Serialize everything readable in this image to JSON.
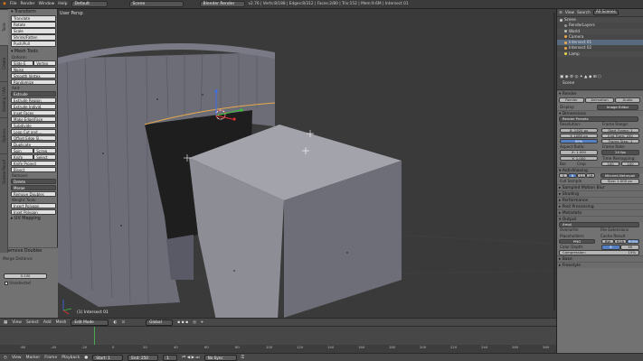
{
  "topbar": {
    "menus": [
      "File",
      "Render",
      "Window",
      "Help"
    ],
    "screen_layout": "Default",
    "scene": "Scene",
    "engine": "Blender Render",
    "stats": "v2.76 | Verts:8/188 | Edges:8/312 | Faces:2/80 | Tris:152 | Mem:9.6M | Intersect 01"
  },
  "toolshelf": {
    "tabs": [
      "Tools",
      "Create",
      "Shading / UVs",
      "Options",
      "Grease Pencil"
    ],
    "transform_header": "▾ Transform",
    "transform_buttons": [
      "Translate",
      "Rotate",
      "Scale",
      "Shrink/Fatten",
      "Push/Pull"
    ],
    "meshtools_header": "▾ Mesh Tools",
    "deform_label": "Deform:",
    "deform_row": [
      "Slide E",
      "Vertex"
    ],
    "deform_buttons": [
      "Noise",
      "Smooth Vertex",
      "Randomize"
    ],
    "add_label": "Add:",
    "add_dropdown": "Extrude",
    "add_buttons": [
      "Extrude Region",
      "Extrude Individ.",
      "Inset Faces",
      "Make Edge/Face",
      "Subdivide",
      "Loop Cut and ...",
      "Offset Edge Sl...",
      "Duplicate"
    ],
    "spin_row": [
      "Spin",
      "Screw"
    ],
    "knife_row": [
      "Knife",
      "Select"
    ],
    "knife_project": "Knife Project",
    "bisect": "Bisect",
    "remove_label": "Remove:",
    "remove_dropdowns": [
      "Delete",
      "Merge"
    ],
    "remove_doubles": "Remove Doubles",
    "weight_label": "Weight Tools:",
    "weight_buttons": [
      "Insert Polygon",
      "Inset Polygon"
    ],
    "uv_header": "▸ UV Mapping",
    "operator_header": "▾ Remove Doubles",
    "merge_distance_label": "Merge Distance",
    "merge_distance_value": "0.100",
    "unselected_label": "Unselected"
  },
  "viewport": {
    "title": "User Persp",
    "object_label": "(1) Intersect 01"
  },
  "viewport_header": {
    "menus": [
      "View",
      "Select",
      "Add",
      "Mesh"
    ],
    "mode": "Edit Mode",
    "pivot": "Global"
  },
  "timeline": {
    "ticks": [
      "-60",
      "-40",
      "-20",
      "0",
      "20",
      "40",
      "60",
      "80",
      "100",
      "120",
      "140",
      "160",
      "180",
      "200",
      "220",
      "240",
      "260",
      "280"
    ]
  },
  "timeline_header": {
    "menus": [
      "View",
      "Marker",
      "Frame",
      "Playback"
    ],
    "start": "Start: 1",
    "end": "End: 250",
    "current": "1",
    "sync": "No Sync"
  },
  "outliner": {
    "header": [
      "View",
      "Search",
      "All Scenes"
    ],
    "rows": [
      "Scene",
      "RenderLayers",
      "World",
      "Camera",
      "Intersect 01",
      "Intersect 02",
      "Lamp"
    ]
  },
  "properties": {
    "scene_label": "Scene",
    "render_header": "▾ Render",
    "render_buttons": [
      "Render",
      "Animation",
      "Audio"
    ],
    "display_label": "Display:",
    "display_value": "Image Editor",
    "dimensions_header": "▾ Dimensions",
    "render_presets": "Render Presets",
    "resolution_label": "Resolution:",
    "res_x": "X: 1920 px",
    "res_y": "Y: 1080 px",
    "res_pct": "50%",
    "frame_range_label": "Frame Range:",
    "start_frame": "Start Frame: 1",
    "end_frame": "End Fram: 250",
    "frame_step": "Frame Step: 1",
    "aspect_label": "Aspect Ratio:",
    "aspect_x": "X: 1.000",
    "aspect_y": "Y: 1.000",
    "frame_rate_label": "Frame Rate:",
    "frame_rate": "24 fps",
    "time_remap_label": "Time Remapping:",
    "remap_old": "100",
    "remap_new": "100",
    "border_label": "Bor",
    "crop_label": "Crop",
    "aa_header": "▾ Anti-Aliasing",
    "aa_samples": [
      "5",
      "8",
      "11",
      "16"
    ],
    "aa_filter": "Mitchell-Netravali",
    "full_sample": "Full Sample",
    "aa_size": "Size: 1.000 px",
    "collapsed_sections": [
      "▸ Sampled Motion Blur",
      "▸ Shading",
      "▸ Performance",
      "▸ Post Processing",
      "▸ Metadata"
    ],
    "output_header": "▾ Output",
    "output_path": "/tmp\\",
    "overwrite": "Overwrite",
    "file_extensions": "File Extensions",
    "placeholders": "Placeholders",
    "cache_result": "Cache Result",
    "format": "PNG",
    "color_modes": [
      "BW",
      "RGB",
      "RGBA"
    ],
    "color_depth_label": "Color Depth:",
    "depth_values": [
      "8",
      "16"
    ],
    "compression": "Compression:",
    "compression_value": "15%",
    "bake_header": "▸ Bake",
    "freestyle_header": "▸ Freestyle"
  },
  "colors": {
    "selected_edge": "#e8a94a",
    "selected_vertex": "#ffffff",
    "accent_blue": "#5680c2"
  }
}
